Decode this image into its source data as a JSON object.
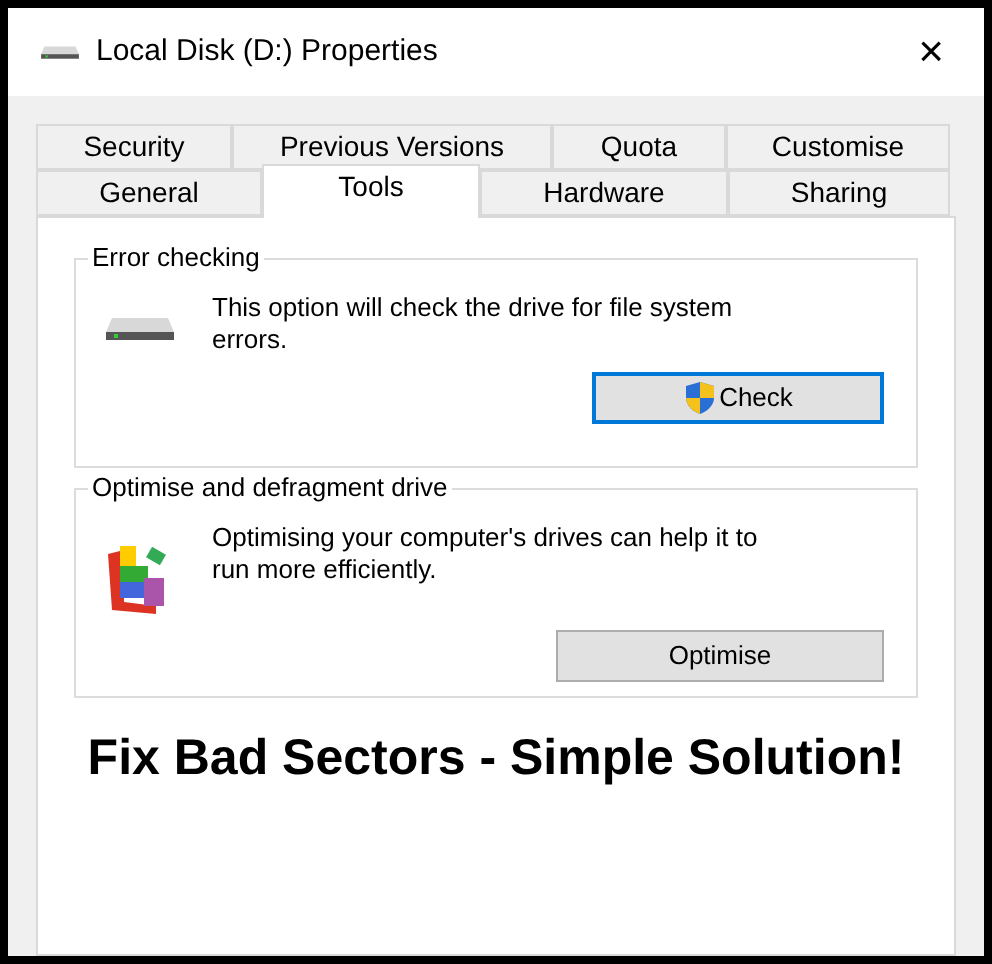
{
  "window": {
    "title": "Local Disk (D:) Properties",
    "close": "×"
  },
  "tab_rows": [
    [
      {
        "label": "Security",
        "selected": false
      },
      {
        "label": "Previous Versions",
        "selected": false
      },
      {
        "label": "Quota",
        "selected": false
      },
      {
        "label": "Customise",
        "selected": false
      }
    ],
    [
      {
        "label": "General",
        "selected": false
      },
      {
        "label": "Tools",
        "selected": true
      },
      {
        "label": "Hardware",
        "selected": false
      },
      {
        "label": "Sharing",
        "selected": false
      }
    ]
  ],
  "groups": [
    {
      "kind": "drive",
      "title": "Error checking",
      "text": "This option will check the drive for file system errors.",
      "button": {
        "kind": "elevated",
        "label": "Check",
        "focused": true
      }
    },
    {
      "kind": "defrag",
      "title": "Optimise and defragment drive",
      "text": "Optimising your computer's drives can help it to run more efficiently.",
      "button": {
        "kind": "plain",
        "label": "Optimise",
        "focused": false
      }
    }
  ],
  "headline": "Fix Bad Sectors - Simple Solution!"
}
